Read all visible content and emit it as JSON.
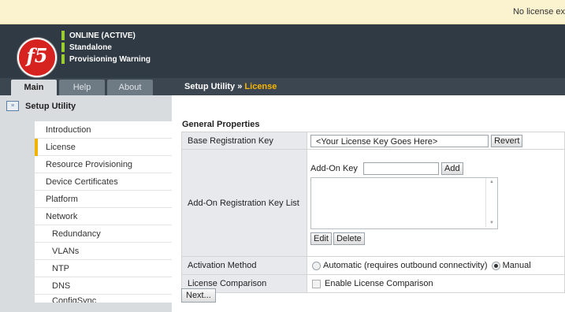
{
  "notice": {
    "text": "No license ex"
  },
  "header": {
    "logo": "f5",
    "status": [
      "ONLINE (ACTIVE)",
      "Standalone",
      "Provisioning Warning"
    ]
  },
  "tabs": [
    {
      "label": "Main",
      "active": true
    },
    {
      "label": "Help",
      "active": false
    },
    {
      "label": "About",
      "active": false
    }
  ],
  "breadcrumb": {
    "section": "Setup Utility",
    "separator": "»",
    "current": "License"
  },
  "sidebar": {
    "heading": "Setup Utility",
    "items": [
      {
        "label": "Introduction"
      },
      {
        "label": "License",
        "selected": true
      },
      {
        "label": "Resource Provisioning"
      },
      {
        "label": "Device Certificates"
      },
      {
        "label": "Platform"
      },
      {
        "label": "Network"
      },
      {
        "label": "Redundancy"
      },
      {
        "label": "VLANs"
      },
      {
        "label": "NTP"
      },
      {
        "label": "DNS"
      },
      {
        "label": "ConfigSync"
      }
    ]
  },
  "main": {
    "section_title": "General Properties",
    "base_key": {
      "label": "Base Registration Key",
      "value": "<Your License Key Goes Here>",
      "revert": "Revert"
    },
    "addon": {
      "label": "Add-On Registration Key List",
      "key_label": "Add-On Key",
      "add": "Add",
      "edit": "Edit",
      "delete": "Delete"
    },
    "activation": {
      "label": "Activation Method",
      "automatic": "Automatic (requires outbound connectivity)",
      "manual": "Manual",
      "selected": "Manual"
    },
    "comparison": {
      "label": "License Comparison",
      "checkbox": "Enable License Comparison",
      "checked": false
    },
    "next": "Next..."
  },
  "colors": {
    "accent": "#f0b400",
    "header": "#2f3a44",
    "status_ok": "#9acd32"
  }
}
